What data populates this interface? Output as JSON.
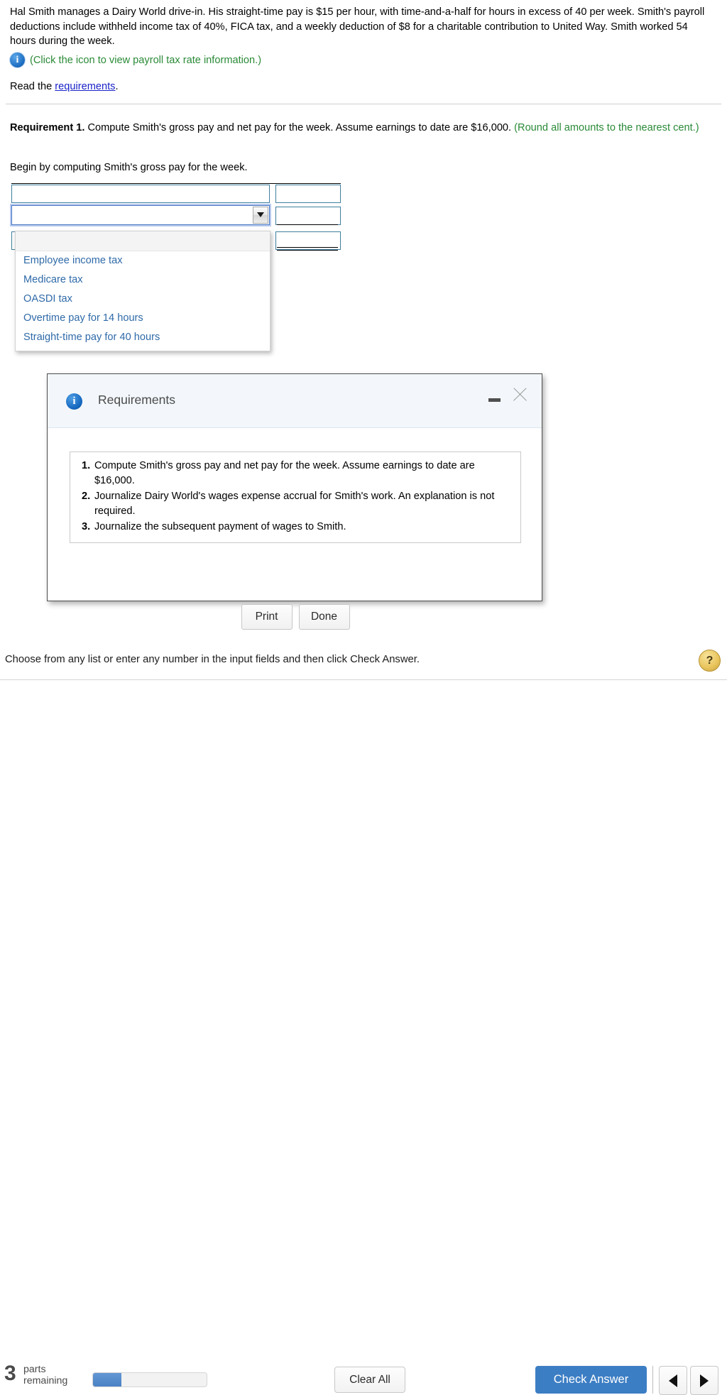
{
  "problem": {
    "statement": "Hal Smith manages a Dairy World drive-in. His straight-time pay is $15 per hour, with time-and-a-half for hours in excess of 40 per week. Smith's payroll deductions include withheld income tax of 40%, FICA tax, and a weekly deduction of $8 for a charitable contribution to United Way. Smith worked 54 hours during the week.",
    "info_note": "(Click the icon to view payroll tax rate information.)",
    "read_prefix": "Read the ",
    "read_link": "requirements",
    "read_suffix": "."
  },
  "requirement": {
    "label": "Requirement 1.",
    "text": " Compute Smith's gross pay and net pay for the week. Assume earnings to date are $16,000. ",
    "round_note": "(Round all amounts to the nearest cent.)",
    "begin": "Begin by computing Smith's gross pay for the week."
  },
  "answer_table": {
    "rows": [
      {
        "label": "",
        "amount": "",
        "underline": "none"
      },
      {
        "label": "",
        "amount": "",
        "underline": "single"
      },
      {
        "label": "",
        "amount": "",
        "underline": "double"
      }
    ]
  },
  "dropdown": {
    "selected": "",
    "options": [
      "",
      "Employee income tax",
      "Medicare tax",
      "OASDI tax",
      "Overtime pay for 14 hours",
      "Straight-time pay for 40 hours"
    ]
  },
  "dialog": {
    "title": "Requirements",
    "items": [
      {
        "num": "1.",
        "text": "Compute Smith's gross pay and net pay for the week. Assume earnings to date are $16,000."
      },
      {
        "num": "2.",
        "text": "Journalize Dairy World's wages expense accrual for Smith's work. An explanation is not required."
      },
      {
        "num": "3.",
        "text": "Journalize the subsequent payment of wages to Smith."
      }
    ],
    "print_label": "Print",
    "done_label": "Done",
    "minimize_label": "Minimize",
    "close_label": "Close"
  },
  "footer": {
    "hint": "Choose from any list or enter any number in the input fields and then click Check Answer.",
    "help_label": "?",
    "parts_number": "3",
    "parts_line1": "parts",
    "parts_line2": "remaining",
    "progress_percent": 25,
    "clear_all_label": "Clear All",
    "check_answer_label": "Check Answer",
    "prev_label": "Previous",
    "next_label": "Next"
  },
  "colors": {
    "accent_blue": "#3c7ec4",
    "link_blue": "#1a23c8",
    "option_blue": "#2f6aa8",
    "green_note": "#2a8a37",
    "field_border": "#3f7f9e",
    "help_gold": "#e9c55e"
  }
}
